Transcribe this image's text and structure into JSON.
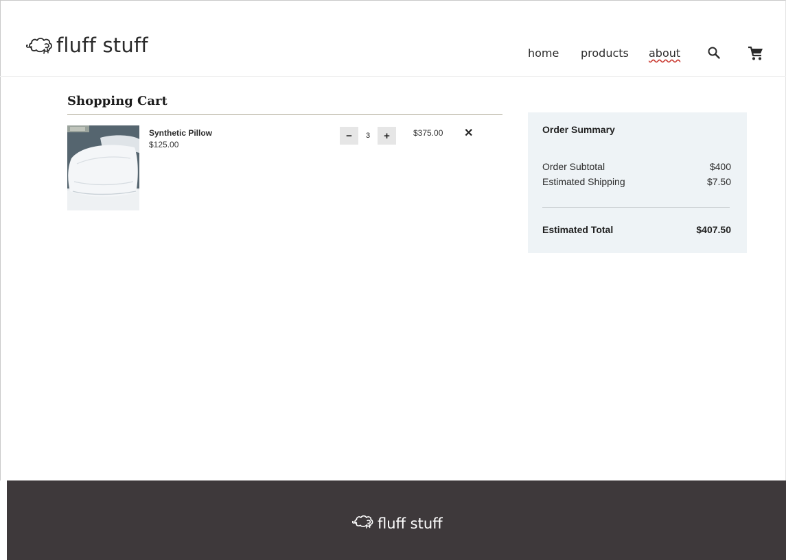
{
  "header": {
    "logo_text": "fluff stuff",
    "nav": {
      "home": "home",
      "products": "products",
      "about": "about"
    },
    "icons": [
      "sheep-logo-icon",
      "search-icon",
      "cart-icon"
    ]
  },
  "cart": {
    "title": "Shopping Cart",
    "items": [
      {
        "name": "Synthetic Pillow",
        "unit_price": "$125.00",
        "quantity": "3",
        "decrement_label": "−",
        "increment_label": "+",
        "line_total": "$375.00",
        "remove_label": "✕"
      }
    ]
  },
  "summary": {
    "title": "Order Summary",
    "subtotal_label": "Order Subtotal",
    "subtotal_value": "$400",
    "shipping_label": "Estimated Shipping",
    "shipping_value": "$7.50",
    "total_label": "Estimated Total",
    "total_value": "$407.50"
  },
  "footer": {
    "logo_text": "fluff stuff"
  },
  "colors": {
    "footer_bg": "#3e393b",
    "summary_bg": "#eef3f6",
    "cart_rule": "#a9a48f",
    "qty_button_bg": "#e6e6e6"
  }
}
